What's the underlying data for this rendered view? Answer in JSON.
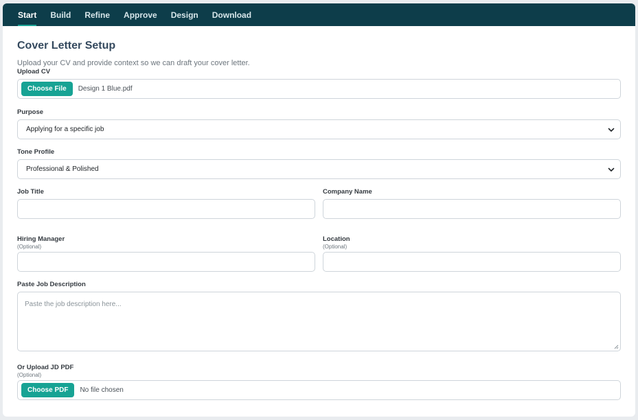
{
  "nav": {
    "tabs": [
      {
        "label": "Start",
        "active": true
      },
      {
        "label": "Build",
        "active": false
      },
      {
        "label": "Refine",
        "active": false
      },
      {
        "label": "Approve",
        "active": false
      },
      {
        "label": "Design",
        "active": false
      },
      {
        "label": "Download",
        "active": false
      }
    ]
  },
  "page": {
    "title": "Cover Letter Setup",
    "subtitle": "Upload your CV and provide context so we can draft your cover letter."
  },
  "form": {
    "cv": {
      "label": "Upload CV",
      "button": "Choose File",
      "file_name": "Design 1 Blue.pdf"
    },
    "purpose": {
      "label": "Purpose",
      "value": "Applying for a specific job"
    },
    "tone": {
      "label": "Tone Profile",
      "value": "Professional & Polished"
    },
    "job_title": {
      "label": "Job Title",
      "value": ""
    },
    "company_name": {
      "label": "Company Name",
      "value": ""
    },
    "hiring_manager": {
      "label": "Hiring Manager",
      "hint": "(Optional)",
      "value": ""
    },
    "location": {
      "label": "Location",
      "hint": "(Optional)",
      "value": ""
    },
    "job_description": {
      "label": "Paste Job Description",
      "placeholder": "Paste the job description here..."
    },
    "jd_pdf": {
      "label": "Or Upload JD PDF",
      "hint": "(Optional)",
      "button": "Choose PDF",
      "file_name": "No file chosen"
    }
  },
  "colors": {
    "nav_bg": "#0d3d4a",
    "accent": "#17a394",
    "title": "#34495e"
  },
  "icons": {
    "select_arrow": "chevron-down-icon",
    "textarea_resize": "resize-handle-icon"
  }
}
